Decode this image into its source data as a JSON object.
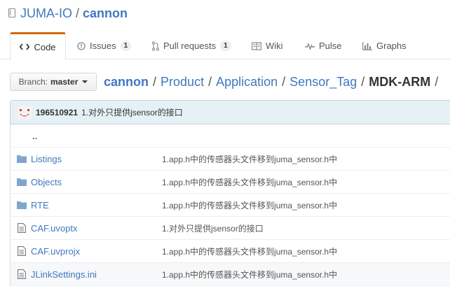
{
  "repo": {
    "owner": "JUMA-IO",
    "separator": "/",
    "name": "cannon"
  },
  "tabs": [
    {
      "label": "Code",
      "icon": "code-icon"
    },
    {
      "label": "Issues",
      "count": "1",
      "icon": "issue-icon"
    },
    {
      "label": "Pull requests",
      "count": "1",
      "icon": "pull-request-icon"
    },
    {
      "label": "Wiki",
      "icon": "book-icon"
    },
    {
      "label": "Pulse",
      "icon": "pulse-icon"
    },
    {
      "label": "Graphs",
      "icon": "graph-icon"
    }
  ],
  "branch": {
    "prefix": "Branch:",
    "name": "master"
  },
  "breadcrumb": {
    "root": "cannon",
    "sep": "/",
    "parts": [
      "Product",
      "Application",
      "Sensor_Tag"
    ],
    "final": "MDK-ARM",
    "trailing": "/"
  },
  "commit": {
    "author": "196510921",
    "message": "1.对外只提供jsensor的接口"
  },
  "files": {
    "up": "..",
    "rows": [
      {
        "type": "folder",
        "name": "Listings",
        "message": "1.app.h中的传感器头文件移到juma_sensor.h中"
      },
      {
        "type": "folder",
        "name": "Objects",
        "message": "1.app.h中的传感器头文件移到juma_sensor.h中"
      },
      {
        "type": "folder",
        "name": "RTE",
        "message": "1.app.h中的传感器头文件移到juma_sensor.h中"
      },
      {
        "type": "file",
        "name": "CAF.uvoptx",
        "message": "1.对外只提供jsensor的接口"
      },
      {
        "type": "file",
        "name": "CAF.uvprojx",
        "message": "1.app.h中的传感器头文件移到juma_sensor.h中"
      },
      {
        "type": "file",
        "name": "JLinkSettings.ini",
        "message": "1.app.h中的传感器头文件移到juma_sensor.h中"
      }
    ]
  },
  "colors": {
    "link": "#4078c0",
    "tab_accent": "#d26911",
    "commit_bg": "#e6f1f6",
    "folder": "#80a6cd"
  }
}
